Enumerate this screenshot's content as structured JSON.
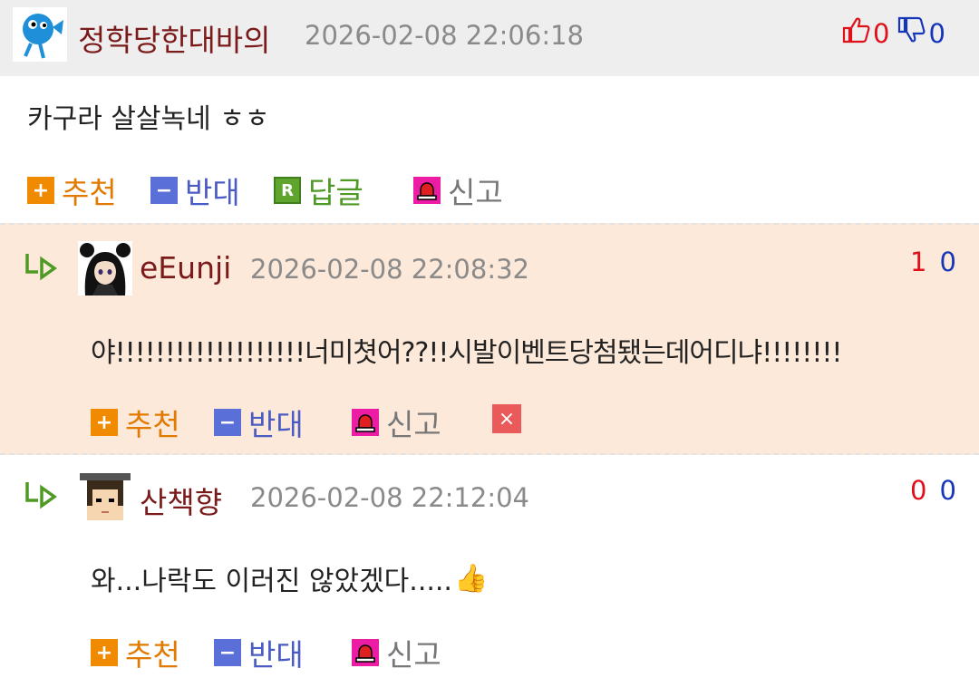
{
  "comments": [
    {
      "author": "정학당한대바의",
      "date": "2026-02-08 22:06:18",
      "body": "카구라 살살녹네 ㅎㅎ",
      "up": "0",
      "down": "0",
      "avatar_icon": "blue-fish-avatar",
      "actions": {
        "recommend": "추천",
        "oppose": "반대",
        "reply": "답글",
        "report": "신고"
      }
    },
    {
      "author": "eEunji",
      "date": "2026-02-08 22:08:32",
      "body": "야!!!!!!!!!!!!!!!!!!!너미쳣어??!!시발이벤트당첨됐는데어디냐!!!!!!!!",
      "up": "1",
      "down": "0",
      "avatar_icon": "anime-girl-avatar",
      "actions": {
        "recommend": "추천",
        "oppose": "반대",
        "report": "신고",
        "delete": "×"
      }
    },
    {
      "author": "산책향",
      "date": "2026-02-08 22:12:04",
      "body": "와...나락도 이러진 않았겠다.....",
      "up": "0",
      "down": "0",
      "avatar_icon": "pixel-graduate-avatar",
      "actions": {
        "recommend": "추천",
        "oppose": "반대",
        "report": "신고"
      }
    }
  ],
  "icons": {
    "plus": "+",
    "minus": "−",
    "reply_box": "R",
    "thumbs_emoji": "👍"
  },
  "colors": {
    "author": "#7a1a1a",
    "up": "#e0101a",
    "down": "#1636b8",
    "recommend": "#e07a00",
    "oppose": "#4a5cc4",
    "reply": "#4e9a24",
    "report": "#ec1ca5",
    "highlight_bg": "#fde9d9"
  }
}
